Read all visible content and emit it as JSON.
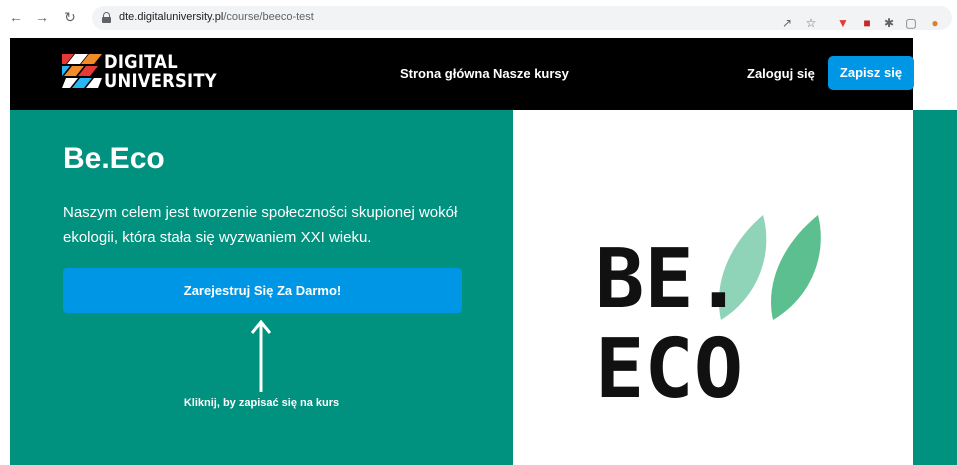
{
  "browser": {
    "url_host": "dte.digitaluniversity.pl",
    "url_path": "/course/beeco-test",
    "icons": [
      "back-arrow-icon",
      "forward-arrow-icon",
      "reload-icon",
      "lock-icon",
      "share-icon",
      "bookmark-star-icon",
      "extension-icon",
      "puzzle-icon",
      "sidepanel-icon",
      "profile-icon"
    ]
  },
  "header": {
    "logo_line1": "DIGITAL",
    "logo_line2": "UNIVERSITY",
    "nav": [
      {
        "label": "Strona główna"
      },
      {
        "label": "Nasze kursy"
      }
    ],
    "login_label": "Zaloguj się",
    "signup_label": "Zapisz się"
  },
  "hero": {
    "title": "Be.Eco",
    "description": "Naszym celem jest tworzenie społeczności skupionej wokół ekologii, która stała się wyzwaniem XXI wieku.",
    "cta_label": "Zarejestruj Się Za Darmo!",
    "hint": "Kliknij, by zapisać się na kurs"
  },
  "course_logo": {
    "line1": "BE.",
    "line2": "ECO"
  },
  "colors": {
    "teal": "#00927f",
    "blue_button": "#0096e6",
    "leaf_light": "#8fd3b8",
    "leaf_dark": "#5cbf8f"
  }
}
